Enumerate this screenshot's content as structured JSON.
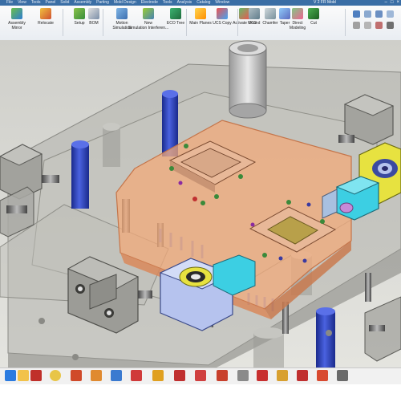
{
  "window": {
    "title": "V 2 FR Mold",
    "menu": [
      "File",
      "View",
      "Tools",
      "Panel",
      "Solid",
      "Assembly",
      "Parting",
      "Mold Design",
      "Electrode",
      "Tools",
      "Analysis",
      "Catalog",
      "Window"
    ],
    "controls": [
      "–",
      "□",
      "×"
    ]
  },
  "ribbon": {
    "buttons": [
      {
        "label": "Assembly",
        "sub": "Mirror"
      },
      {
        "label": "Relocate",
        "sub": ""
      },
      {
        "label": "Setup",
        "sub": ""
      },
      {
        "label": "BOM",
        "sub": ""
      },
      {
        "label": "Motion",
        "sub": "Simulation"
      },
      {
        "label": "New",
        "sub": "Simulation Interferen..."
      },
      {
        "label": "ECO Tree",
        "sub": ""
      },
      {
        "label": "Main Planes",
        "sub": ""
      },
      {
        "label": "UCS Copy",
        "sub": ""
      },
      {
        "label": "Activate UCS",
        "sub": ""
      },
      {
        "label": "Round",
        "sub": ""
      },
      {
        "label": "Chamfer",
        "sub": ""
      },
      {
        "label": "Taper",
        "sub": ""
      },
      {
        "label": "Direct",
        "sub": "Modeling"
      },
      {
        "label": "Cut",
        "sub": ""
      }
    ]
  },
  "icons": {
    "taskbar": [
      "start-icon",
      "file-explorer-icon",
      "filezilla-icon",
      "chrome-icon",
      "app-icon-1",
      "app-icon-2",
      "app-icon-3",
      "app-icon-4",
      "app-icon-5",
      "app-icon-6",
      "app-icon-7",
      "app-icon-8",
      "app-icon-9",
      "app-icon-10",
      "app-icon-11",
      "app-icon-12",
      "app-icon-13",
      "app-icon-14"
    ]
  },
  "colors": {
    "ribbon_bg": "#eef1f5",
    "titlebar": "#3a6ea5",
    "plate_orange": "#f2a97a",
    "blue_pin": "#2f3fb8",
    "yellow_part": "#e7e240",
    "cyan_part": "#3ccfe3",
    "lavender_part": "#b6c3ee"
  }
}
